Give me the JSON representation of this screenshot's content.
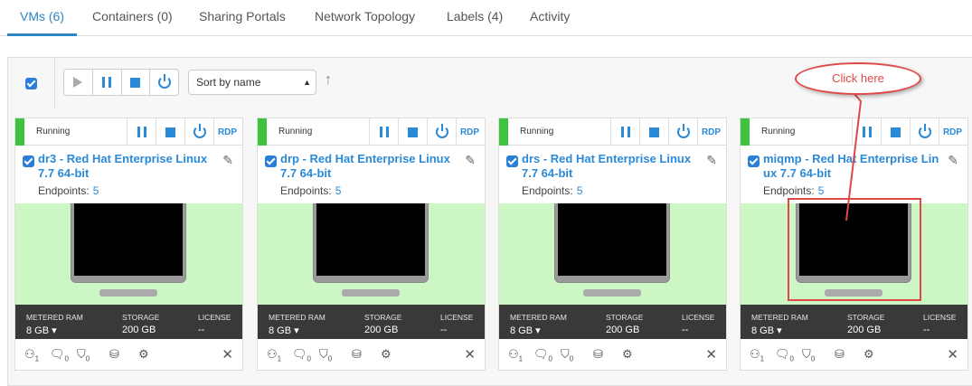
{
  "tabs": [
    {
      "label": "VMs (6)",
      "active": true
    },
    {
      "label": "Containers (0)"
    },
    {
      "label": "Sharing Portals"
    },
    {
      "label": "Network Topology"
    },
    {
      "label": "Labels (4)"
    },
    {
      "label": "Activity"
    }
  ],
  "toolbar": {
    "sort_label": "Sort by name",
    "sort_arrow": "↑"
  },
  "stat_labels": {
    "ram": "METERED RAM",
    "storage": "STORAGE",
    "license": "LICENSE"
  },
  "vms": [
    {
      "status": "Running",
      "rdp": "RDP",
      "title": "dr3 - Red Hat Enterprise Linux 7.7 64-bit",
      "endpoints_label": "Endpoints:",
      "endpoints": "5",
      "ram": "8 GB ▾",
      "storage": "200 GB",
      "license": "--",
      "users": "1",
      "comments": "0",
      "tags": "0"
    },
    {
      "status": "Running",
      "rdp": "RDP",
      "title": "drp - Red Hat Enterprise Linux 7.7 64-bit",
      "endpoints_label": "Endpoints:",
      "endpoints": "5",
      "ram": "8 GB ▾",
      "storage": "200 GB",
      "license": "--",
      "users": "1",
      "comments": "0",
      "tags": "0"
    },
    {
      "status": "Running",
      "rdp": "RDP",
      "title": "drs - Red Hat Enterprise Linux 7.7 64-bit",
      "endpoints_label": "Endpoints:",
      "endpoints": "5",
      "ram": "8 GB ▾",
      "storage": "200 GB",
      "license": "--",
      "users": "1",
      "comments": "0",
      "tags": "0"
    },
    {
      "status": "Running",
      "rdp": "RDP",
      "title": "miqmp - Red Hat Enterprise Linux 7.7 64-bit",
      "endpoints_label": "Endpoints:",
      "endpoints": "5",
      "ram": "8 GB ▾",
      "storage": "200 GB",
      "license": "--",
      "users": "1",
      "comments": "0",
      "tags": "0"
    }
  ],
  "annotation": {
    "callout_text": "Click here",
    "color": "#e04848"
  },
  "colors": {
    "accent": "#2b8ad8",
    "running": "#3fc33f",
    "screen_bg": "#ccf7c5",
    "stats_bg": "#393939"
  }
}
